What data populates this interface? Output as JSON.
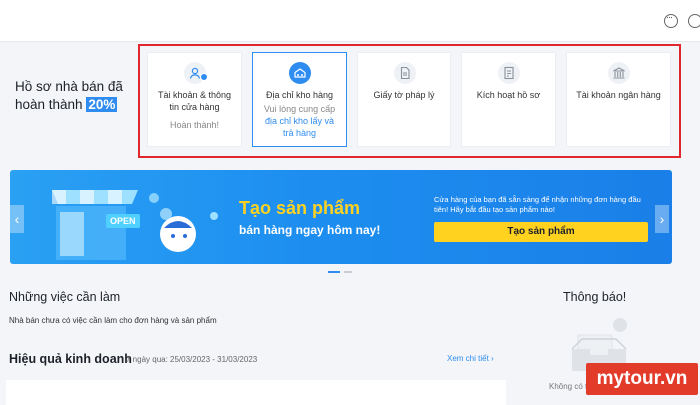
{
  "progress": {
    "label": "Hồ sơ nhà bán đã hoàn thành",
    "percent": "20%"
  },
  "steps": [
    {
      "title": "Tài khoản & thông tin cửa hàng",
      "sub": "Hoàn thành!",
      "icon": "user-check-icon"
    },
    {
      "title": "Địa chỉ kho hàng",
      "sub_prefix": "Vui lòng cung cấp ",
      "sub_link": "địa chỉ kho lấy và trả hàng",
      "icon": "warehouse-icon"
    },
    {
      "title": "Giấy tờ pháp lý",
      "icon": "document-icon"
    },
    {
      "title": "Kích hoạt hồ sơ",
      "icon": "profile-icon"
    },
    {
      "title": "Tài khoản ngân hàng",
      "icon": "bank-icon"
    }
  ],
  "banner": {
    "headline": "Tạo sản phẩm",
    "subline": "bán hàng ngay hôm nay!",
    "description": "Cửa hàng của bạn đã sẵn sàng để nhận những đơn hàng đầu tiên! Hãy bắt đầu tạo sản phẩm nào!",
    "cta": "Tạo sản phẩm",
    "shop_sign": "OPEN"
  },
  "todo": {
    "title": "Những việc cần làm",
    "subtitle": "Nhà bán chưa có việc cần làm cho đơn hàng và sản phẩm"
  },
  "performance": {
    "title": "Hiệu quả kinh doanh",
    "range": "7 ngày qua: 25/03/2023 - 31/03/2023",
    "more": "Xem chi tiết"
  },
  "notice": {
    "title": "Thông báo!",
    "empty": "Không có th"
  },
  "watermark": "mytour.vn",
  "colors": {
    "accent": "#2f8cf0",
    "highlight": "#e0262e",
    "banner": "#1d8ef0",
    "cta": "#ffd21f"
  }
}
